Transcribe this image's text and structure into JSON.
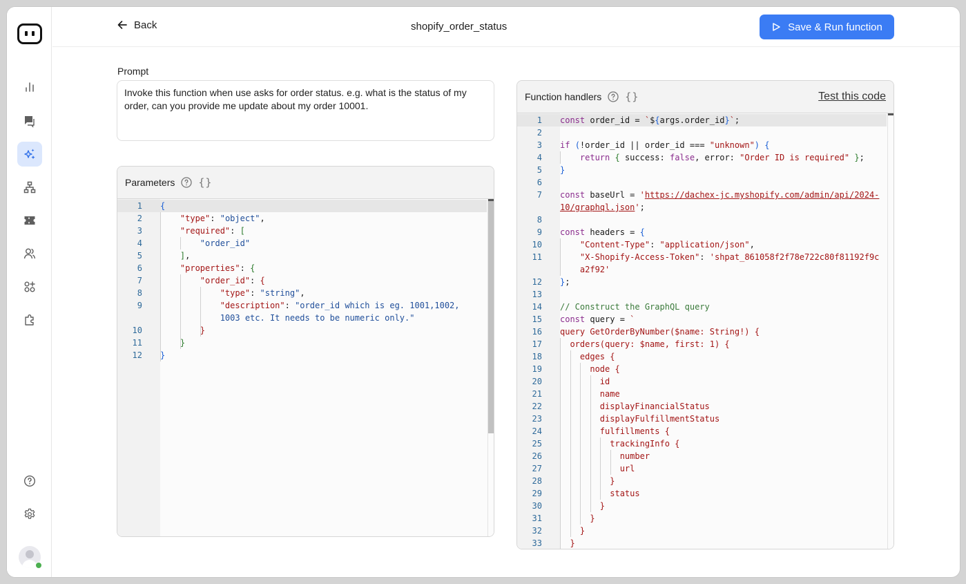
{
  "sidebar": {
    "items": [
      {
        "name": "analytics",
        "icon": "bar-chart-icon",
        "active": false
      },
      {
        "name": "conversations",
        "icon": "chat-icon",
        "active": false
      },
      {
        "name": "ai-functions",
        "icon": "sparkles-icon",
        "active": true
      },
      {
        "name": "workflows",
        "icon": "hierarchy-icon",
        "active": false
      },
      {
        "name": "tickets",
        "icon": "ticket-icon",
        "active": false
      },
      {
        "name": "users",
        "icon": "users-icon",
        "active": false
      },
      {
        "name": "apps",
        "icon": "apps-add-icon",
        "active": false
      },
      {
        "name": "integrations",
        "icon": "puzzle-icon",
        "active": false
      }
    ],
    "bottom": [
      {
        "name": "help",
        "icon": "help-circle-icon"
      },
      {
        "name": "settings",
        "icon": "gear-icon"
      }
    ],
    "user_status": "online",
    "accent": "#3b7cf4"
  },
  "header": {
    "back_label": "Back",
    "title": "shopify_order_status",
    "run_label": "Save & Run function"
  },
  "prompt": {
    "label": "Prompt",
    "value": "Invoke this function when use asks for order status. e.g. what is the status of my order, can you provide me update about my order 10001."
  },
  "parameters": {
    "title": "Parameters",
    "format_icon": "{}",
    "lines": [
      "{",
      "    \"type\": \"object\",",
      "    \"required\": [",
      "        \"order_id\"",
      "    ],",
      "    \"properties\": {",
      "        \"order_id\": {",
      "            \"type\": \"string\",",
      "            \"description\": \"order_id which is eg. 1001,1002, 1003 etc. It needs to be numeric only.\"",
      "        }",
      "    }",
      "}"
    ]
  },
  "handlers": {
    "title": "Function handlers",
    "format_icon": "{}",
    "test_label": "Test this code",
    "lines": [
      "const order_id = `${args.order_id}`;",
      "",
      "if (!order_id || order_id === \"unknown\") {",
      "    return { success: false, error: \"Order ID is required\" };",
      "}",
      "",
      "const baseUrl = 'https://dachex-jc.myshopify.com/admin/api/2024-10/graphql.json';",
      "",
      "const headers = {",
      "    \"Content-Type\": \"application/json\",",
      "    \"X-Shopify-Access-Token\": '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'",
      "};",
      "",
      "// Construct the GraphQL query",
      "const query = `",
      "query GetOrderByNumber($name: String!) {",
      "  orders(query: $name, first: 1) {",
      "    edges {",
      "      node {",
      "        id",
      "        name",
      "        displayFinancialStatus",
      "        displayFulfillmentStatus",
      "        fulfillments {",
      "          trackingInfo {",
      "            number",
      "            url",
      "          }",
      "          status",
      "        }",
      "      }",
      "    }",
      "  }"
    ]
  }
}
